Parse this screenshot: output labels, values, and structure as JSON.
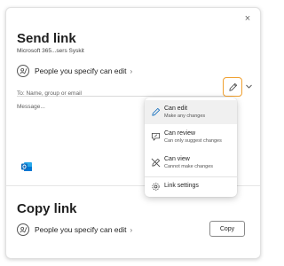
{
  "dialog": {
    "close_label": "×",
    "send": {
      "title": "Send link",
      "subtitle": "Microsoft 365...sers Syskit",
      "permission_label": "People you specify can edit",
      "to_placeholder": "To: Name, group or email",
      "message_placeholder": "Message..."
    },
    "copy": {
      "title": "Copy link",
      "permission_label": "People you specify can edit",
      "button_label": "Copy"
    }
  },
  "permission_menu": {
    "items": [
      {
        "title": "Can edit",
        "description": "Make any changes",
        "icon": "pencil-icon",
        "selected": true
      },
      {
        "title": "Can review",
        "description": "Can only suggest changes",
        "icon": "review-icon",
        "selected": false
      },
      {
        "title": "Can view",
        "description": "Cannot make changes",
        "icon": "no-edit-icon",
        "selected": false
      }
    ],
    "settings_label": "Link settings",
    "settings_icon": "gear-icon"
  },
  "colors": {
    "accent_outline": "#f0a030",
    "outlook_blue": "#0f6cbd",
    "selected_row": "#f0f0f0"
  }
}
